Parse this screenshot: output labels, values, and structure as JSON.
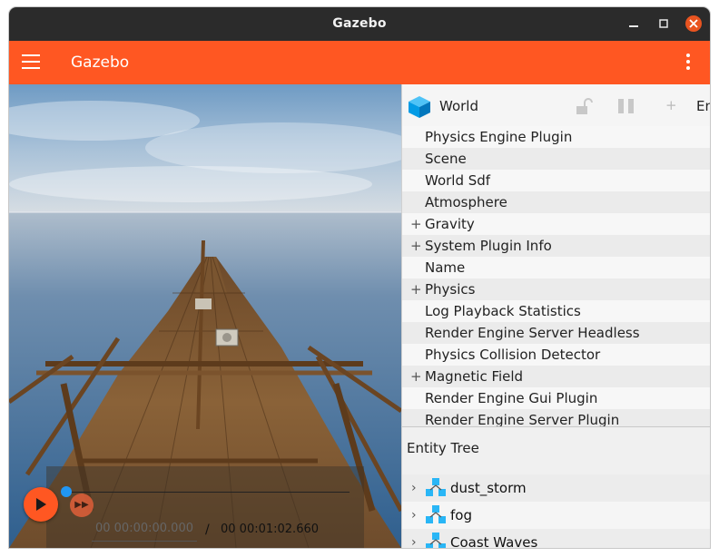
{
  "window": {
    "title": "Gazebo"
  },
  "appbar": {
    "title": "Gazebo"
  },
  "playback": {
    "current_time": "00 00:00:00.000",
    "separator": "/",
    "total_time": "00 00:01:02.660",
    "progress": 0
  },
  "component_inspector": {
    "entity_name": "World",
    "truncated_label": "En",
    "components": [
      {
        "label": "Physics Engine Plugin",
        "expandable": false
      },
      {
        "label": "Scene",
        "expandable": false
      },
      {
        "label": "World Sdf",
        "expandable": false
      },
      {
        "label": "Atmosphere",
        "expandable": false
      },
      {
        "label": "Gravity",
        "expandable": true
      },
      {
        "label": "System Plugin Info",
        "expandable": true
      },
      {
        "label": "Name",
        "expandable": false
      },
      {
        "label": "Physics",
        "expandable": true
      },
      {
        "label": "Log Playback Statistics",
        "expandable": false
      },
      {
        "label": "Render Engine Server Headless",
        "expandable": false
      },
      {
        "label": "Physics Collision Detector",
        "expandable": false
      },
      {
        "label": "Magnetic Field",
        "expandable": true
      },
      {
        "label": "Render Engine Gui Plugin",
        "expandable": false
      },
      {
        "label": "Render Engine Server Plugin",
        "expandable": false
      }
    ]
  },
  "entity_tree": {
    "title": "Entity Tree",
    "items": [
      {
        "label": "dust_storm"
      },
      {
        "label": "fog"
      },
      {
        "label": "Coast Waves"
      }
    ]
  },
  "colors": {
    "accent": "#ff5722",
    "titlebar": "#2b2b2b",
    "close_button": "#e95420",
    "slider_thumb": "#2196f3",
    "model_icon": "#29b6f6"
  },
  "icons": {
    "menu": "hamburger-icon",
    "more": "kebab-icon",
    "world": "cube-icon",
    "lock": "unlock-icon",
    "pause": "pause-icon",
    "add": "plus-icon",
    "play": "play-icon",
    "step": "fast-forward-icon",
    "model": "model-icon",
    "expand": "chevron-right-icon"
  }
}
